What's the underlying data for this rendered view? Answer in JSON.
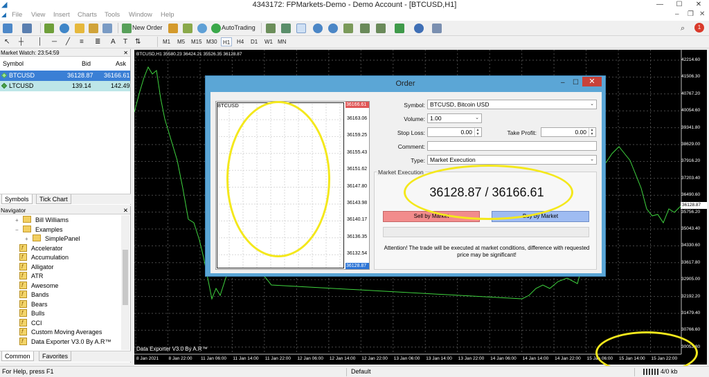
{
  "window": {
    "title": "4343172: FPMarkets-Demo - Demo Account - [BTCUSD,H1]",
    "controls": [
      "—",
      "☐",
      "✕"
    ]
  },
  "menu": [
    "File",
    "View",
    "Insert",
    "Charts",
    "Tools",
    "Window",
    "Help"
  ],
  "toolbar": {
    "new_order": "New Order",
    "auto_trading": "AutoTrading",
    "timeframes": [
      "M1",
      "M5",
      "M15",
      "M30",
      "H1",
      "H4",
      "D1",
      "W1",
      "MN"
    ],
    "active_timeframe": "H1"
  },
  "market_watch": {
    "header": "Market Watch: 23:54:59",
    "columns": {
      "symbol": "Symbol",
      "bid": "Bid",
      "ask": "Ask"
    },
    "rows": [
      {
        "symbol": "BTCUSD",
        "bid": "36128.87",
        "ask": "36166.61"
      },
      {
        "symbol": "LTCUSD",
        "bid": "139.14",
        "ask": "142.49"
      }
    ],
    "tabs": [
      "Symbols",
      "Tick Chart"
    ]
  },
  "navigator": {
    "header": "Navigator",
    "items": [
      {
        "label": "Bill Williams",
        "kind": "folder",
        "toggle": "+"
      },
      {
        "label": "Examples",
        "kind": "folder",
        "toggle": "−"
      },
      {
        "label": "SimplePanel",
        "kind": "folder",
        "toggle": "+"
      },
      {
        "label": "Accelerator",
        "kind": "indicator"
      },
      {
        "label": "Accumulation",
        "kind": "indicator"
      },
      {
        "label": "Alligator",
        "kind": "indicator"
      },
      {
        "label": "ATR",
        "kind": "indicator"
      },
      {
        "label": "Awesome",
        "kind": "indicator"
      },
      {
        "label": "Bands",
        "kind": "indicator"
      },
      {
        "label": "Bears",
        "kind": "indicator"
      },
      {
        "label": "Bulls",
        "kind": "indicator"
      },
      {
        "label": "CCI",
        "kind": "indicator"
      },
      {
        "label": "Custom Moving Averages",
        "kind": "indicator"
      },
      {
        "label": "Data Exporter V3.0 By A.R™",
        "kind": "indicator"
      }
    ],
    "tabs": [
      "Common",
      "Favorites"
    ]
  },
  "chart": {
    "info": "BTCUSD,H1  35580.23 36424.21 35526.35 36128.87",
    "indicator_label": "Data Exporter V3.0 By A.R™",
    "price_axis": [
      "42214.60",
      "41506.30",
      "40767.20",
      "40054.60",
      "39341.80",
      "38629.00",
      "37916.20",
      "37203.40",
      "36490.60",
      "35756.20",
      "35043.40",
      "34330.60",
      "33617.80",
      "32905.00",
      "32192.20",
      "31479.40",
      "30766.60",
      "30053.80"
    ],
    "current_price": "36128.87",
    "time_axis": [
      "8 Jan 2021",
      "8 Jan 22:00",
      "11 Jan 06:00",
      "11 Jan 14:00",
      "11 Jan 22:00",
      "12 Jan 06:00",
      "12 Jan 14:00",
      "12 Jan 22:00",
      "13 Jan 06:00",
      "13 Jan 14:00",
      "13 Jan 22:00",
      "14 Jan 06:00",
      "14 Jan 14:00",
      "14 Jan 22:00",
      "15 Jan 06:00",
      "15 Jan 14:00",
      "15 Jan 22:00"
    ],
    "line_color": "#3fd43f",
    "grid_color": "#4a4a4a"
  },
  "order_dialog": {
    "title": "Order",
    "mini_chart": {
      "symbol": "BTCUSD",
      "price_labels": [
        "36163.06",
        "36159.25",
        "36155.43",
        "36151.62",
        "36147.80",
        "36143.98",
        "36140.17",
        "36136.35",
        "36132.54"
      ],
      "ask": "36166.61",
      "bid": "36128.87"
    },
    "symbol_label": "Symbol:",
    "symbol_value": "BTCUSD, Bitcoin USD",
    "volume_label": "Volume:",
    "volume_value": "1.00",
    "stop_loss_label": "Stop Loss:",
    "stop_loss_value": "0.00",
    "take_profit_label": "Take Profit:",
    "take_profit_value": "0.00",
    "comment_label": "Comment:",
    "comment_value": "",
    "type_label": "Type:",
    "type_value": "Market Execution",
    "execution_group": "Market Execution",
    "price_display": "36128.87 / 36166.61",
    "sell_button": "Sell by Market",
    "buy_button": "Buy by Market",
    "attention": "Attention! The trade will be executed at market conditions, difference with requested price may be significant!"
  },
  "status_bar": {
    "help": "For Help, press F1",
    "profile": "Default",
    "traffic": "4/0 kb"
  },
  "highlight_color": "#f4e81c",
  "accent_selected": "#3a7fd5"
}
